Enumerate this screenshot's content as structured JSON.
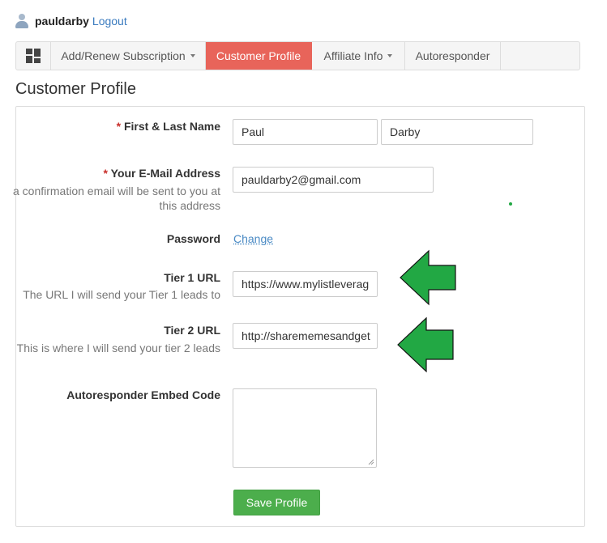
{
  "user": {
    "name": "pauldarby",
    "logout_label": "Logout"
  },
  "nav": {
    "items": [
      {
        "label": "Add/Renew Subscription"
      },
      {
        "label": "Customer Profile"
      },
      {
        "label": "Affiliate Info"
      },
      {
        "label": "Autoresponder"
      }
    ]
  },
  "page": {
    "title": "Customer Profile"
  },
  "form": {
    "required_mark": "*",
    "name": {
      "label": "First & Last Name",
      "first_value": "Paul",
      "last_value": "Darby"
    },
    "email": {
      "label": "Your E-Mail Address",
      "help": "a confirmation email will be sent to you at this address",
      "value": "pauldarby2@gmail.com"
    },
    "password": {
      "label": "Password",
      "link": "Change"
    },
    "tier1": {
      "label": "Tier 1 URL",
      "help": "The URL I will send your Tier 1 leads to",
      "value": "https://www.mylistleverag"
    },
    "tier2": {
      "label": "Tier 2 URL",
      "help": "This is where I will send your tier 2 leads",
      "value": "http://sharememesandget"
    },
    "autoresponder": {
      "label": "Autoresponder Embed Code",
      "value": ""
    },
    "save_label": "Save Profile"
  },
  "colors": {
    "accent": "#e8645a",
    "success": "#4cae4c",
    "arrow": "#22a844",
    "link": "#3a7bbf"
  }
}
